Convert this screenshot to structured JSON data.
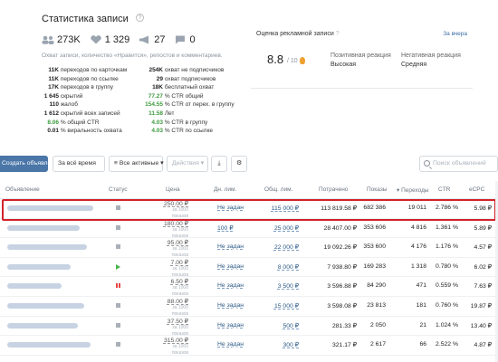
{
  "stats": {
    "title": "Статистика записи",
    "help": "?",
    "metrics": {
      "members": "273K",
      "likes": "1 329",
      "reposts": "27",
      "comments": "0"
    },
    "description": "Охват записи, количество «Нравится», репостов и комментариев.",
    "left": [
      {
        "num": "11K",
        "label": "переходов по карточкам",
        "green": false
      },
      {
        "num": "11K",
        "label": "переходов по ссылке",
        "green": false
      },
      {
        "num": "17K",
        "label": "переходов в группу",
        "green": false
      },
      {
        "num": "1 645",
        "label": "скрытий",
        "green": false
      },
      {
        "num": "110",
        "label": "жалоб",
        "green": false
      },
      {
        "num": "1 612",
        "label": "скрытий всех записей",
        "green": false
      },
      {
        "num": "8.06",
        "label": "% общий CTR",
        "green": true
      },
      {
        "num": "0.01",
        "label": "% виральность охвата",
        "green": false
      }
    ],
    "right": [
      {
        "num": "254K",
        "label": "охват не подписчиков",
        "green": false
      },
      {
        "num": "29",
        "label": "охват подписчиков",
        "green": false
      },
      {
        "num": "18K",
        "label": "бесплатный охват",
        "green": false
      },
      {
        "num": "77.27",
        "label": "% CTR общий",
        "green": true
      },
      {
        "num": "154.55",
        "label": "% CTR от перех. в группу",
        "green": true
      },
      {
        "num": "11.58",
        "label": "Лет",
        "green": true
      },
      {
        "num": "4.03",
        "label": "% CTR в группу",
        "green": true
      },
      {
        "num": "4.03",
        "label": "% CTR по ссылке",
        "green": true
      }
    ]
  },
  "rating": {
    "title": "Оценка рекламной записи",
    "help": "?",
    "link": "За вчера",
    "score": "8.8",
    "scale": "/ 10",
    "positive_label": "Позитивная реакция",
    "positive_value": "Высокая",
    "negative_label": "Негативная реакция",
    "negative_value": "Средняя"
  },
  "toolbar": {
    "create": "Создать объявление",
    "period": "За всё время",
    "filter": "Все активные",
    "actions": "Действия",
    "search_placeholder": "Поиск объявлений"
  },
  "table": {
    "headers": {
      "ad": "Объявление",
      "status": "Статус",
      "price": "Цена",
      "day_limit": "Дн. лим.",
      "total_limit": "Общ. лим.",
      "spent": "Потрачено",
      "views": "Показы",
      "clicks": "Переходы",
      "ctr": "CTR",
      "ecpc": "eCPC"
    },
    "rows": [
      {
        "status": "stop",
        "price": "250.00 ₽",
        "price_sub": "за 1000 показов",
        "day": "Не задан",
        "total": "115 000 ₽",
        "spent": "113 819.58 ₽",
        "views": "682 386",
        "clicks": "19 011",
        "ctr": "2.786 %",
        "ecpc": "5.98 ₽",
        "blur": 95
      },
      {
        "status": "stop",
        "price": "180.00 ₽",
        "price_sub": "за 1000 показов",
        "day": "100 ₽",
        "total": "25 000 ₽",
        "spent": "28 407.00 ₽",
        "views": "353 606",
        "clicks": "4 816",
        "ctr": "1.361 %",
        "ecpc": "5.89 ₽",
        "blur": 80
      },
      {
        "status": "stop",
        "price": "95.00 ₽",
        "price_sub": "за 1000 показов",
        "day": "Не задан",
        "total": "22 000 ₽",
        "spent": "19 092.26 ₽",
        "views": "353 600",
        "clicks": "4 176",
        "ctr": "1.176 %",
        "ecpc": "4.57 ₽",
        "blur": 88
      },
      {
        "status": "play",
        "price": "7.00 ₽",
        "price_sub": "за 1000 показов",
        "day": "Не задан",
        "total": "8 000 ₽",
        "spent": "7 938.80 ₽",
        "views": "169 283",
        "clicks": "1 318",
        "ctr": "0.780 %",
        "ecpc": "6.02 ₽",
        "blur": 70
      },
      {
        "status": "pause",
        "price": "6.50 ₽",
        "price_sub": "за 1000 показов",
        "day": "Не задан",
        "total": "3 500 ₽",
        "spent": "3 596.88 ₽",
        "views": "84 290",
        "clicks": "471",
        "ctr": "0.559 %",
        "ecpc": "7.63 ₽",
        "blur": 60
      },
      {
        "status": "stop",
        "price": "88.00 ₽",
        "price_sub": "за 1000 показов",
        "day": "Не задан",
        "total": "15 000 ₽",
        "spent": "3 598.08 ₽",
        "views": "23 813",
        "clicks": "181",
        "ctr": "0.760 %",
        "ecpc": "19.87 ₽",
        "blur": 85
      },
      {
        "status": "stop",
        "price": "37.50 ₽",
        "price_sub": "за 1000 показов",
        "day": "Не задан",
        "total": "500 ₽",
        "spent": "281.33 ₽",
        "views": "2 050",
        "clicks": "21",
        "ctr": "1.024 %",
        "ecpc": "13.40 ₽",
        "blur": 78
      },
      {
        "status": "stop",
        "price": "315.00 ₽",
        "price_sub": "за 1000 показов",
        "day": "Не задан",
        "total": "300 ₽",
        "spent": "321.17 ₽",
        "views": "2 617",
        "clicks": "66",
        "ctr": "2.522 %",
        "ecpc": "4.87 ₽",
        "blur": 92
      }
    ]
  }
}
